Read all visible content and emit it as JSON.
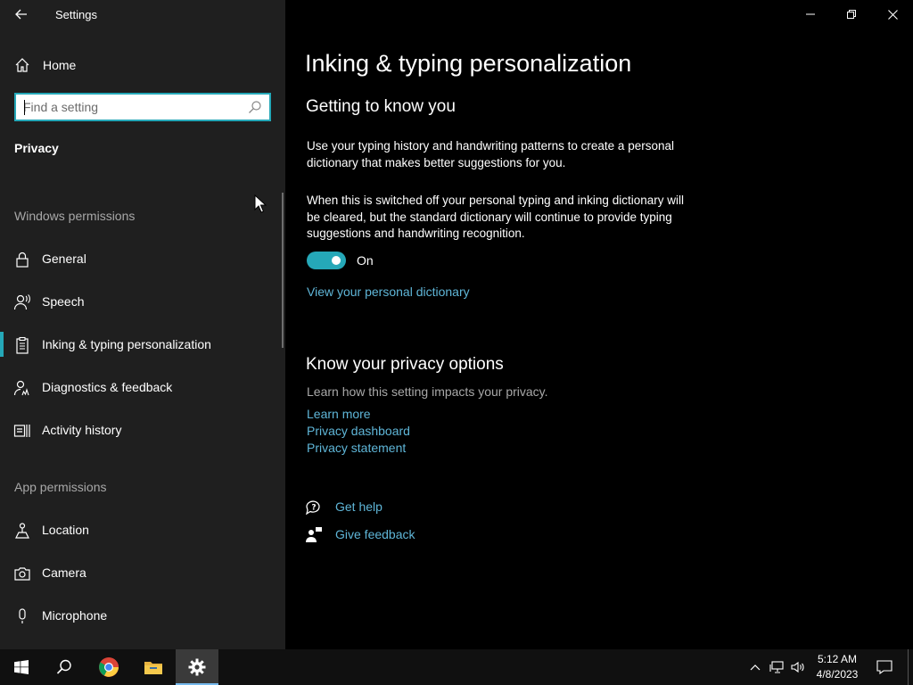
{
  "window": {
    "title": "Settings"
  },
  "sidebar": {
    "home_label": "Home",
    "search_placeholder": "Find a setting",
    "section_title": "Privacy",
    "windows_permissions_header": "Windows permissions",
    "windows_items": [
      {
        "label": "General",
        "icon": "lock-icon"
      },
      {
        "label": "Speech",
        "icon": "speech-icon"
      },
      {
        "label": "Inking & typing personalization",
        "icon": "clipboard-icon",
        "active": true
      },
      {
        "label": "Diagnostics & feedback",
        "icon": "diagnostics-icon"
      },
      {
        "label": "Activity history",
        "icon": "timeline-icon"
      }
    ],
    "app_permissions_header": "App permissions",
    "app_items": [
      {
        "label": "Location",
        "icon": "location-icon"
      },
      {
        "label": "Camera",
        "icon": "camera-icon"
      },
      {
        "label": "Microphone",
        "icon": "microphone-icon"
      }
    ]
  },
  "main": {
    "page_title": "Inking & typing personalization",
    "getting_to_know": {
      "heading": "Getting to know you",
      "para1": "Use your typing history and handwriting patterns to create a personal dictionary that makes better suggestions for you.",
      "para2": "When this is switched off your personal typing and inking dictionary will be cleared, but the standard dictionary will continue to provide typing suggestions and handwriting recognition.",
      "toggle_state": "On",
      "dictionary_link": "View your personal dictionary"
    },
    "privacy_options": {
      "heading": "Know your privacy options",
      "subtitle": "Learn how this setting impacts your privacy.",
      "links": [
        "Learn more",
        "Privacy dashboard",
        "Privacy statement"
      ]
    },
    "help": {
      "get_help": "Get help",
      "give_feedback": "Give feedback"
    }
  },
  "taskbar": {
    "time": "5:12 AM",
    "date": "4/8/2023"
  },
  "colors": {
    "accent": "#25a8b8",
    "link": "#5fb6d8",
    "sidebar_bg": "#1f1f1f",
    "main_bg": "#000000"
  }
}
